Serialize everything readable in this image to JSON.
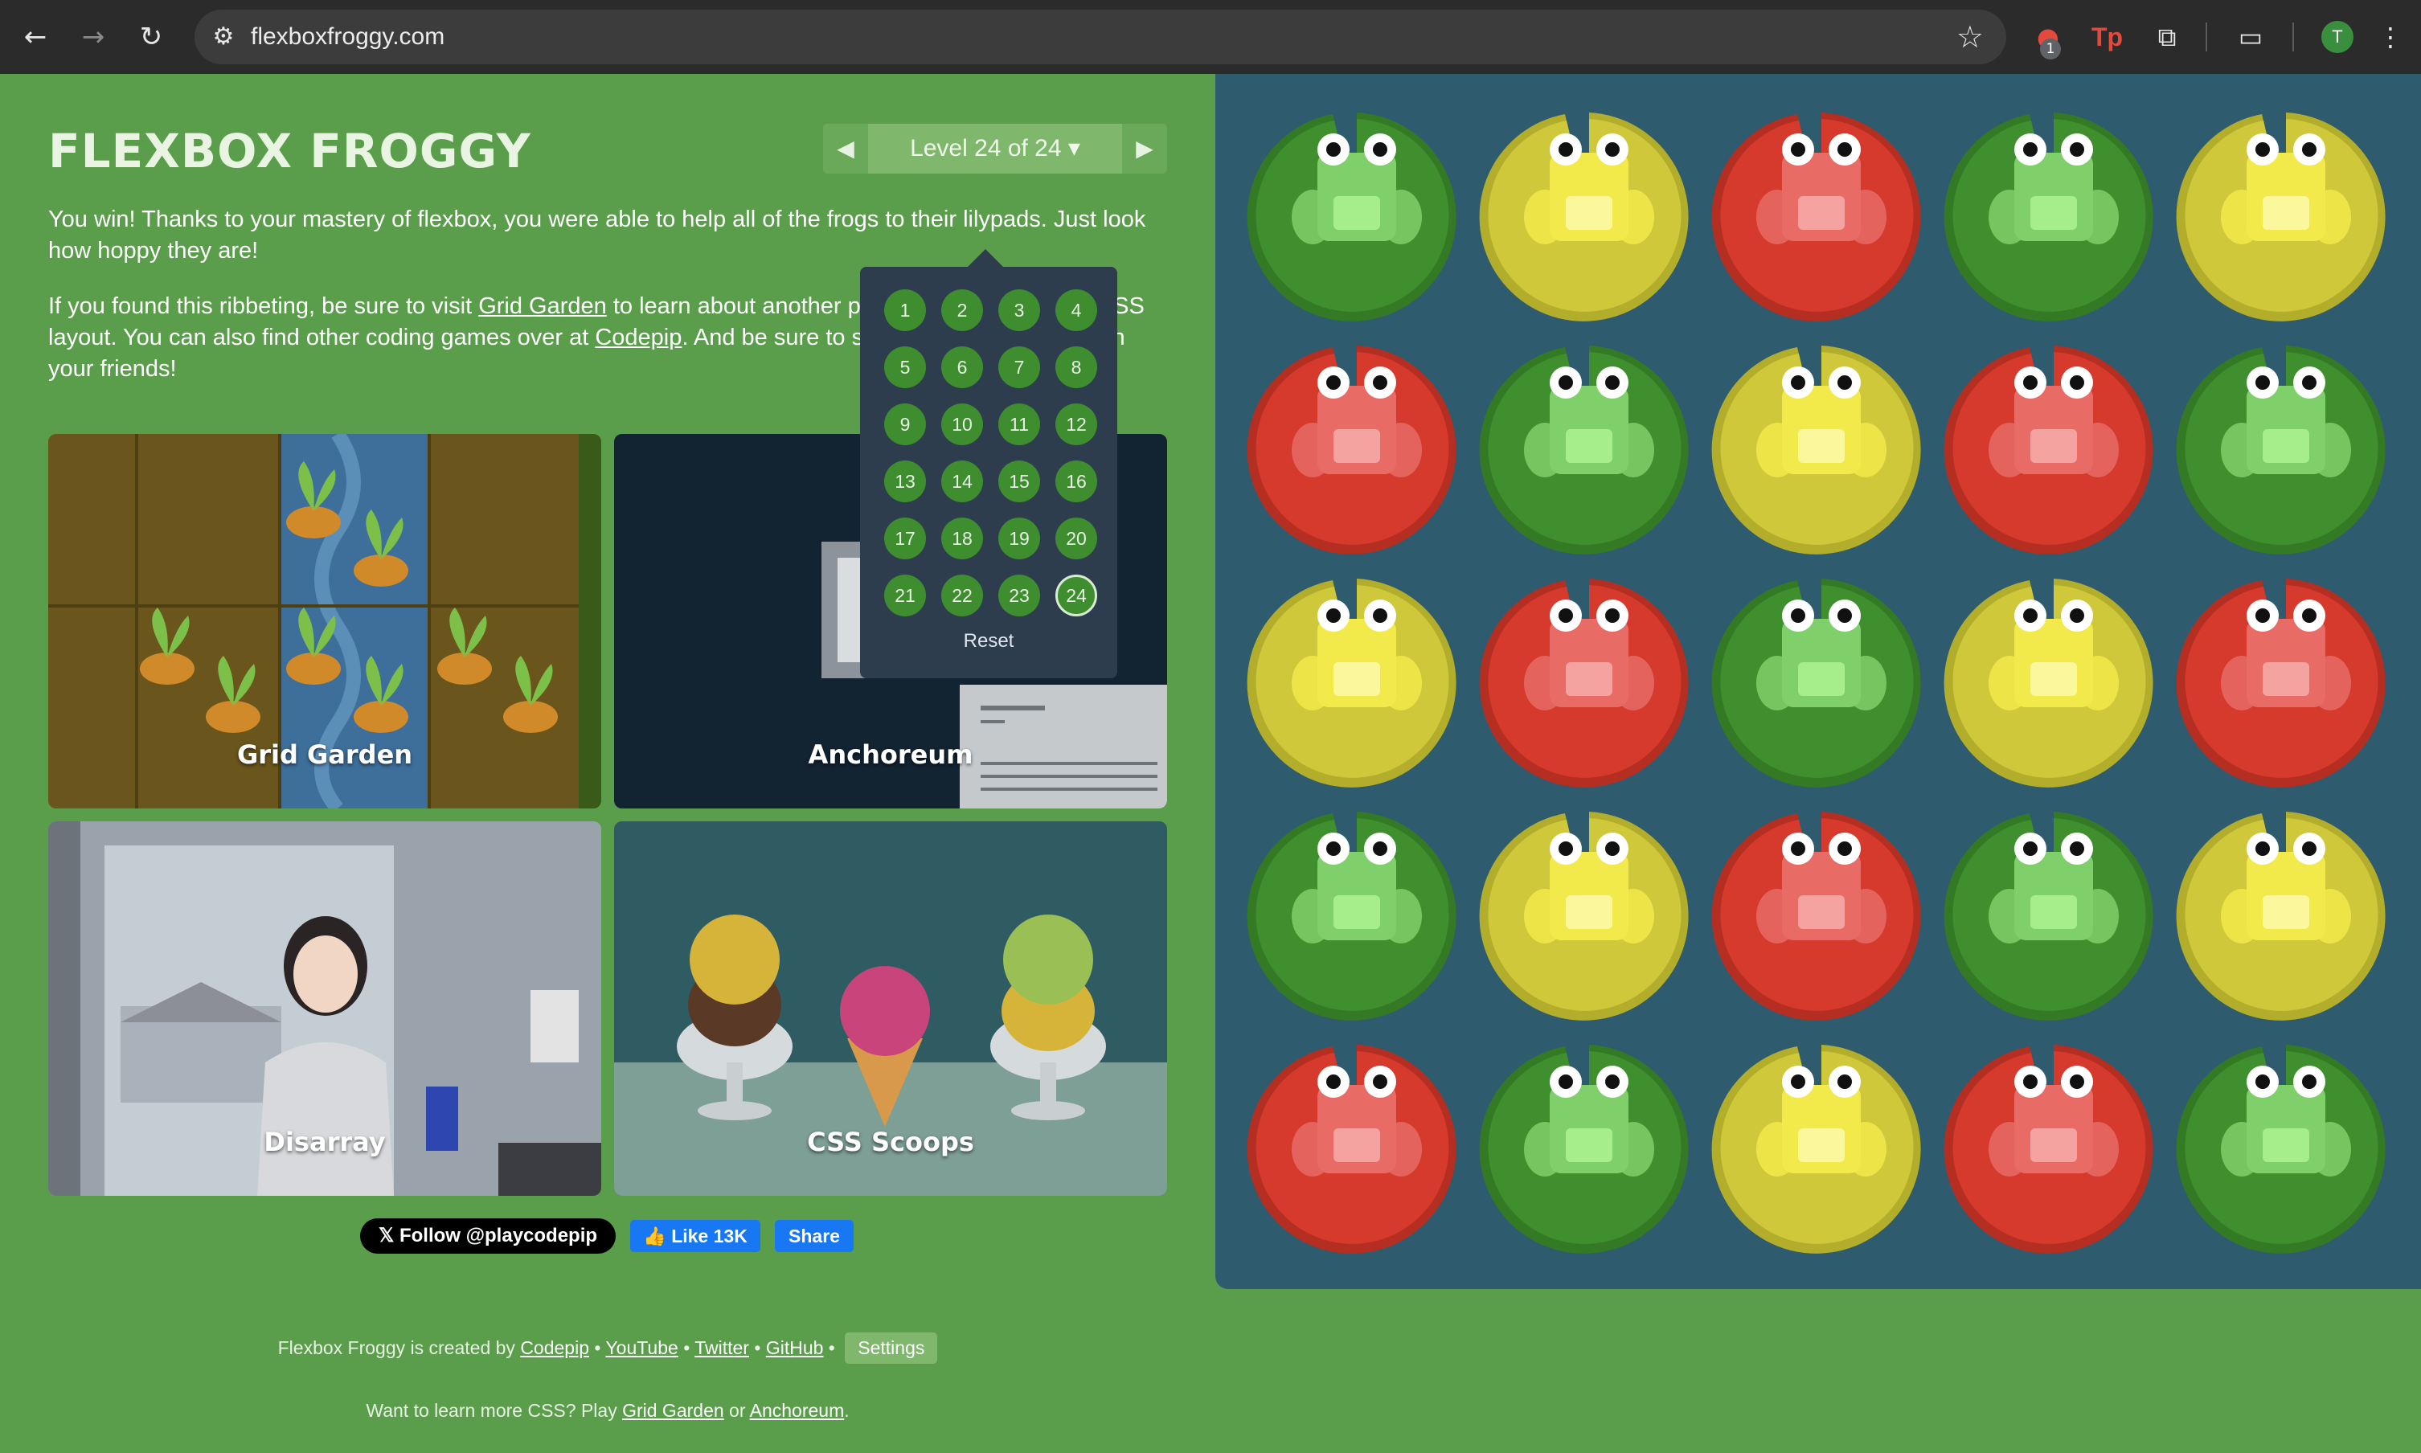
{
  "browser": {
    "url": "flexboxfroggy.com",
    "icons": [
      "back-icon",
      "forward-icon",
      "reload-icon",
      "site-settings-icon",
      "bookmark-star-icon",
      "extension-icon",
      "puzzle-icon",
      "cast-icon",
      "profile-avatar"
    ],
    "ext_badge": "1",
    "tp_label": "Tp",
    "avatar_initial": "T"
  },
  "header": {
    "title": "FLEXBOX FROGGY",
    "level_label": "Level 24 of 24 ▾"
  },
  "intro": {
    "p1": "You win! Thanks to your mastery of flexbox, you were able to help all of the frogs to their lilypads. Just look how hoppy they are!",
    "p2_before": "If you found this ribbeting, be sure to visit ",
    "p2_link1": "Grid Garden",
    "p2_mid": " to learn about another powerful new feature of CSS layout. You can also find other coding games over at ",
    "p2_link2": "Codepip",
    "p2_after": ". And be sure to share Flexbox Froggy with your friends!"
  },
  "games": [
    {
      "label": "Grid Garden"
    },
    {
      "label": "Anchoreum"
    },
    {
      "label": "Disarray"
    },
    {
      "label": "CSS Scoops"
    }
  ],
  "level_menu": {
    "levels": [
      "1",
      "2",
      "3",
      "4",
      "5",
      "6",
      "7",
      "8",
      "9",
      "10",
      "11",
      "12",
      "13",
      "14",
      "15",
      "16",
      "17",
      "18",
      "19",
      "20",
      "21",
      "22",
      "23",
      "24"
    ],
    "current": "24",
    "reset_label": "Reset"
  },
  "social": {
    "follow_label": "𝕏 Follow @playcodepip",
    "like_label": "👍 Like 13K",
    "share_label": "Share"
  },
  "footer": {
    "created_by": "Flexbox Froggy is created by ",
    "links": [
      "Codepip",
      "YouTube",
      "Twitter",
      "GitHub"
    ],
    "settings_label": "Settings",
    "learn_more": "Want to learn more CSS? Play ",
    "learn_link1": "Grid Garden",
    "learn_or": " or ",
    "learn_link2": "Anchoreum",
    "learn_end": "."
  },
  "pond": {
    "colors": {
      "green": "#3f8f2e",
      "yellow": "#cfc83a",
      "red": "#d63a2c",
      "water": "#2f5b6e"
    },
    "grid": [
      [
        "green",
        "yellow",
        "red",
        "green",
        "yellow"
      ],
      [
        "red",
        "green",
        "yellow",
        "red",
        "green"
      ],
      [
        "yellow",
        "red",
        "green",
        "yellow",
        "red"
      ],
      [
        "green",
        "yellow",
        "red",
        "green",
        "yellow"
      ],
      [
        "red",
        "green",
        "yellow",
        "red",
        "green"
      ]
    ]
  }
}
